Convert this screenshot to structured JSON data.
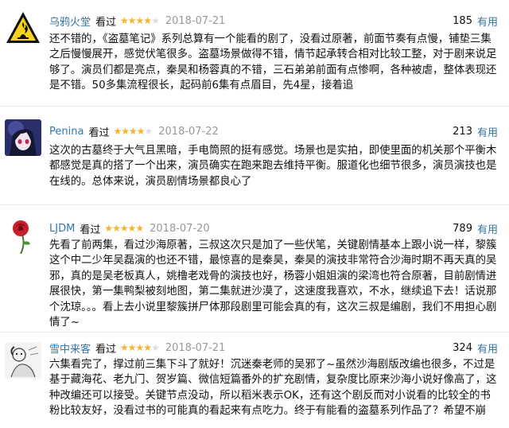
{
  "reviews": [
    {
      "user": "乌鸦火堂",
      "status": "看过",
      "rating": 4,
      "date": "2018-07-21",
      "votes": "185",
      "useful_label": "有用",
      "avatar_icon": "warning-flame-icon",
      "text": "还不错的，《盗墓笔记》系列总算有一个能看的剧了，没看过原著，前面节奏有点慢，铺垫三集之后慢慢展开，感觉伏笔很多。盗墓场景做得不错，情节起承转合相对比较工整，对于剧来说足够了。演员们都是亮点，秦昊和杨蓉真的不错，三石弟弟前面有点惨啊，各种被虐，整体表现还是不错。50多集流程很长，起码前6集有点眉目，先4星，接着追"
    },
    {
      "user": "Penina",
      "status": "看过",
      "rating": 4,
      "date": "2018-07-22",
      "votes": "213",
      "useful_label": "有用",
      "avatar_icon": "anime-character-icon",
      "text": "这次的古墓终于大气且黑暗，手电筒照的挺有感觉。场景也是实拍，即使里面的机关那个平衡木都感觉是真的搭了一个出来，演员确实在跑来跑去维持平衡。服道化也细节很多，演员演技也是在线的。总体来说，演员剧情场景都良心了"
    },
    {
      "user": "LJDM",
      "status": "看过",
      "rating": 5,
      "date": "2018-07-20",
      "votes": "789",
      "useful_label": "有用",
      "avatar_icon": "rose-icon",
      "text": "先看了前两集，看过沙海原著，三叔这次只是加了一些伏笔，关键剧情基本上跟小说一样，黎簇这个中二少年吴磊演的也还不错，最惊喜的是秦昊，秦昊的演技非常符合沙海时期不再天真的吴邪，真的是吴老板真人，姚橹老戏骨的演技也好，杨蓉小姐姐演的梁湾也符合原著，目前剧情进展很快，第一集鸭梨被刻地图，第二集就进沙漠了，这速度我喜欢，不水，继续追下去！话说那个沈琼。。。看上去小说里黎簇拼尸体那段剧里可能会真的有，这次三叔是编剧，我们不用担心剧情了~"
    },
    {
      "user": "雪中来客",
      "status": "看过",
      "rating": 4,
      "date": "2018-07-21",
      "votes": "324",
      "useful_label": "有用",
      "avatar_icon": "ink-sketch-icon",
      "text": "六集看完了，撑过前三集下斗了就好！沉迷秦老师的吴邪了~虽然沙海剧版改编也很多，不过是基于藏海花、老九门、贺岁篇、微信短篇番外的扩充剧情，复杂度比原来沙海小说好像高了，这种改编还可以接受。关键节点没动，所以稻米表示OK，还有这个剧反而对小说看的比较全的书粉比较友好，没看过书的可能真的看起来有点吃力。终于有能看的盗墓系列作品了？希望不崩"
    }
  ]
}
